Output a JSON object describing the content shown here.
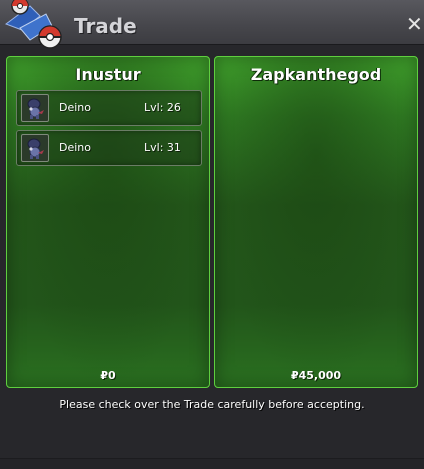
{
  "window": {
    "title": "Trade",
    "close_symbol": "✕"
  },
  "left_trader": {
    "name": "Inustur",
    "money": "₽0",
    "slots": [
      {
        "name": "Deino",
        "level": "Lvl: 26"
      },
      {
        "name": "Deino",
        "level": "Lvl: 31"
      }
    ]
  },
  "right_trader": {
    "name": "Zapkanthegod",
    "money": "₽45,000"
  },
  "notice": "Please check over the Trade carefully before accepting.",
  "colors": {
    "panel_green": "#2f7a22",
    "panel_border": "#5fcf3f",
    "titlebar": "#4a4a50"
  },
  "icons": {
    "logo": "pokeball-logo-icon",
    "slot_icon": "deino-icon"
  }
}
